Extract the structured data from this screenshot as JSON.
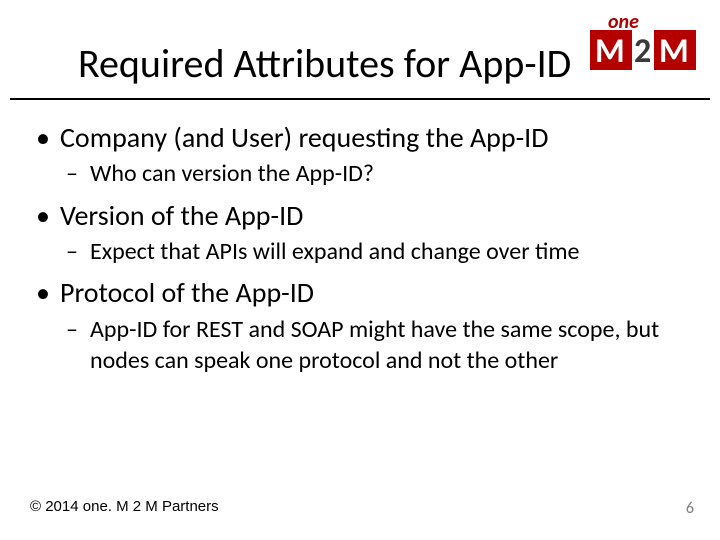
{
  "slide": {
    "title": "Required Attributes for App-ID",
    "bullets": [
      {
        "text": "Company (and User) requesting the App-ID",
        "sub": [
          {
            "text": "Who can version the App-ID?"
          }
        ]
      },
      {
        "text": "Version of the App-ID",
        "sub": [
          {
            "text": "Expect that APIs will expand and change over time"
          }
        ]
      },
      {
        "text": "Protocol of the App-ID",
        "sub": [
          {
            "text": "App-ID for REST and SOAP might have the same scope, but nodes can speak one protocol and not the other"
          }
        ]
      }
    ],
    "footer_copyright": "© 2014 one. M 2 M Partners",
    "page_number": "6",
    "logo": {
      "one": "one",
      "m": "M",
      "two": "2",
      "m2": "M"
    }
  }
}
